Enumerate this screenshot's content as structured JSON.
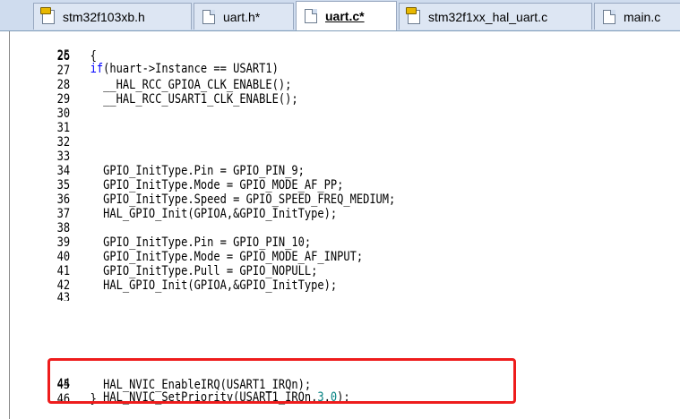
{
  "tabs": [
    {
      "label": "stm32f103xb.h",
      "icon": "header-file-icon"
    },
    {
      "label": "uart.h*",
      "icon": "file-icon"
    },
    {
      "label": "uart.c*",
      "icon": "file-icon",
      "active": true
    },
    {
      "label": "stm32f1xx_hal_uart.c",
      "icon": "header-file-icon"
    },
    {
      "label": "main.c",
      "icon": "file-icon"
    }
  ],
  "code_lines": [
    {
      "n": "25",
      "t": ""
    },
    {
      "n": "26",
      "t": "{"
    },
    {
      "n": "27",
      "t": ""
    },
    {
      "n": "28",
      "t": "  __HAL_RCC_GPIOA_CLK_ENABLE();"
    },
    {
      "n": "29",
      "t": "  __HAL_RCC_USART1_CLK_ENABLE();"
    },
    {
      "n": "30",
      "t": ""
    },
    {
      "n": "31",
      "t": ""
    },
    {
      "n": "32",
      "t": ""
    },
    {
      "n": "33",
      "t": ""
    },
    {
      "n": "34",
      "t": "  GPIO_InitType.Pin = GPIO_PIN_9;"
    },
    {
      "n": "35",
      "t": "  GPIO_InitType.Mode = GPIO_MODE_AF_PP;"
    },
    {
      "n": "36",
      "t": "  GPIO_InitType.Speed = GPIO_SPEED_FREQ_MEDIUM;"
    },
    {
      "n": "37",
      "t": "  HAL_GPIO_Init(GPIOA,&GPIO_InitType);"
    },
    {
      "n": "38",
      "t": ""
    },
    {
      "n": "39",
      "t": "  GPIO_InitType.Pin = GPIO_PIN_10;"
    },
    {
      "n": "40",
      "t": "  GPIO_InitType.Mode = GPIO_MODE_AF_INPUT;"
    },
    {
      "n": "41",
      "t": "  GPIO_InitType.Pull = GPIO_NOPULL;"
    },
    {
      "n": "42",
      "t": "  HAL_GPIO_Init(GPIOA,&GPIO_InitType);"
    },
    {
      "n": "43",
      "t": ""
    },
    {
      "n": "44",
      "t": ""
    },
    {
      "n": "45",
      "t": "  HAL_NVIC_EnableIRQ(USART1_IRQn);"
    },
    {
      "n": "46",
      "t": "}"
    }
  ],
  "line25": {
    "kw": "if",
    "rest": "(huart->Instance == USART1)"
  },
  "line44": {
    "pre": "  HAL_NVIC_SetPriority(USART1_IRQn,",
    "a": "3",
    "sep": ",",
    "b": "0",
    "post": ");"
  },
  "colors": {
    "keyword": "#0000ff",
    "number": "#008080",
    "highlight": "#ee1c1c",
    "tabbar": "#cfdcee"
  }
}
